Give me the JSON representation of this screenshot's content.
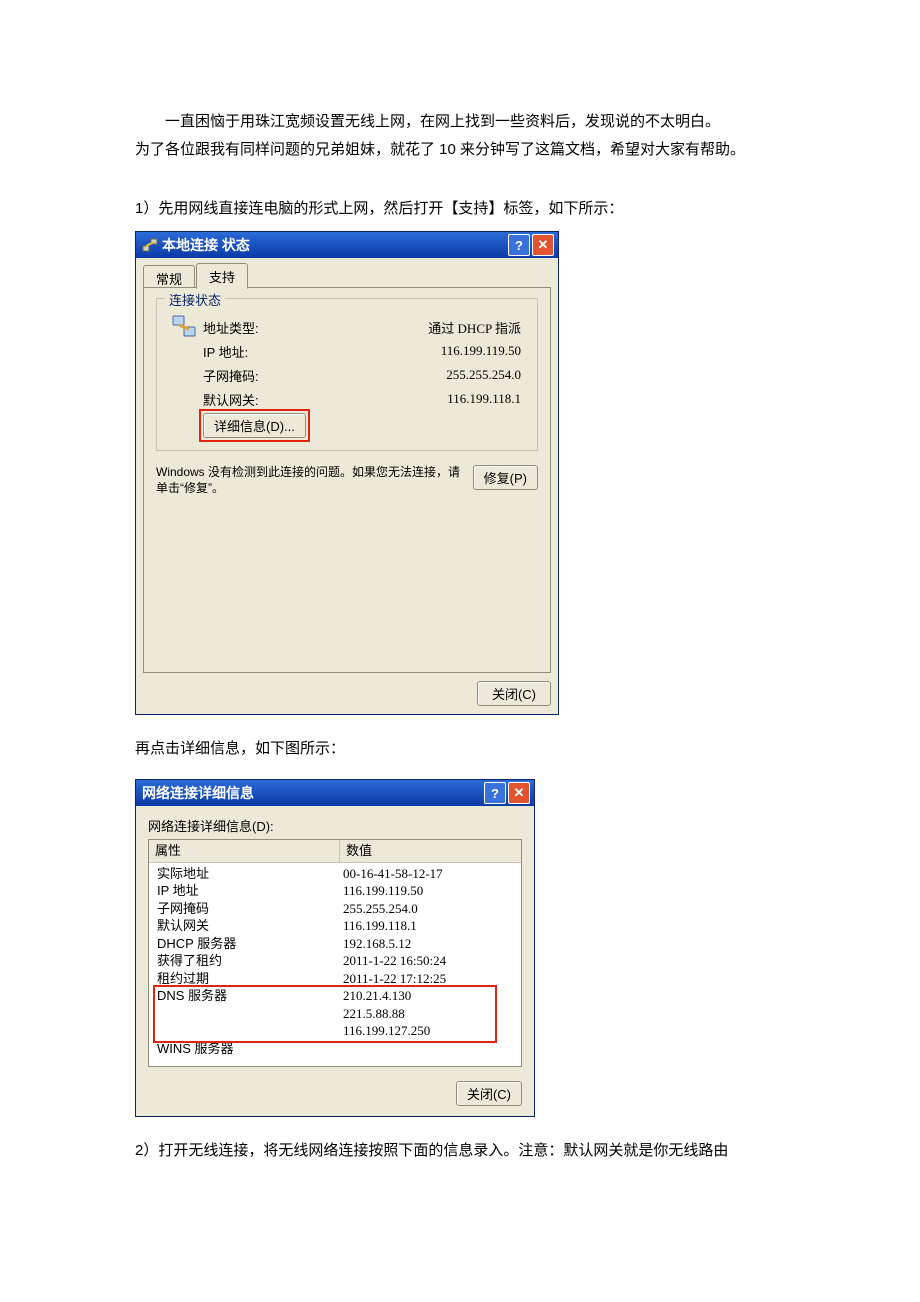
{
  "doc": {
    "intro_line1": "一直困恼于用珠江宽频设置无线上网，在网上找到一些资料后，发现说的不太明白。",
    "intro_line2": "为了各位跟我有同样问题的兄弟姐妹，就花了 10 来分钟写了这篇文档，希望对大家有帮助。",
    "step1": "1）先用网线直接连电脑的形式上网，然后打开【支持】标签，如下所示：",
    "after1": "再点击详细信息，如下图所示：",
    "step2": "2）打开无线连接，将无线网络连接按照下面的信息录入。注意：默认网关就是你无线路由"
  },
  "dlg1": {
    "title": "本地连接 状态",
    "tab_general": "常规",
    "tab_support": "支持",
    "group_title": "连接状态",
    "rows": {
      "addr_type_label": "地址类型:",
      "addr_type_value": "通过 DHCP 指派",
      "ip_label": "IP 地址:",
      "ip_value": "116.199.119.50",
      "mask_label": "子网掩码:",
      "mask_value": "255.255.254.0",
      "gw_label": "默认网关:",
      "gw_value": "116.199.118.1"
    },
    "details_btn": "详细信息(D)...",
    "repair_text": "Windows 没有检测到此连接的问题。如果您无法连接，请单击“修复”。",
    "repair_btn": "修复(P)",
    "close_btn": "关闭(C)"
  },
  "dlg2": {
    "title": "网络连接详细信息",
    "label": "网络连接详细信息(D):",
    "head_prop": "属性",
    "head_val": "数值",
    "rows": [
      {
        "p": "实际地址",
        "v": "00-16-41-58-12-17"
      },
      {
        "p": "IP 地址",
        "v": "116.199.119.50"
      },
      {
        "p": "子网掩码",
        "v": "255.255.254.0"
      },
      {
        "p": "默认网关",
        "v": "116.199.118.1"
      },
      {
        "p": "DHCP 服务器",
        "v": "192.168.5.12"
      },
      {
        "p": "获得了租约",
        "v": "2011-1-22 16:50:24"
      },
      {
        "p": "租约过期",
        "v": "2011-1-22 17:12:25"
      },
      {
        "p": "DNS 服务器",
        "v": "210.21.4.130"
      },
      {
        "p": "",
        "v": "221.5.88.88"
      },
      {
        "p": "",
        "v": "116.199.127.250"
      },
      {
        "p": "WINS 服务器",
        "v": ""
      }
    ],
    "close_btn": "关闭(C)"
  }
}
